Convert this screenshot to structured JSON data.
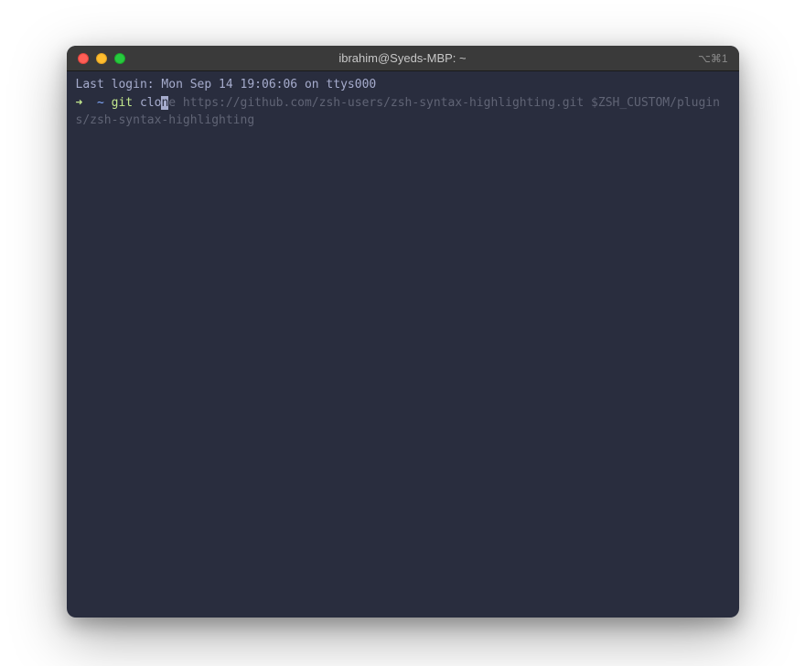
{
  "window": {
    "title": "ibrahim@Syeds-MBP: ~",
    "tab_indicator": "⌥⌘1"
  },
  "terminal": {
    "last_login": "Last login: Mon Sep 14 19:06:06 on ttys000",
    "prompt": {
      "arrow": "➜ ",
      "tilde": " ~ ",
      "git_command": "git",
      "typed_prefix": " clo",
      "cursor_char": "n",
      "autosuggest_rest": "e https://github.com/zsh-users/zsh-syntax-highlighting.git $ZSH_CUSTOM/plugins/zsh-syntax-highlighting"
    }
  }
}
